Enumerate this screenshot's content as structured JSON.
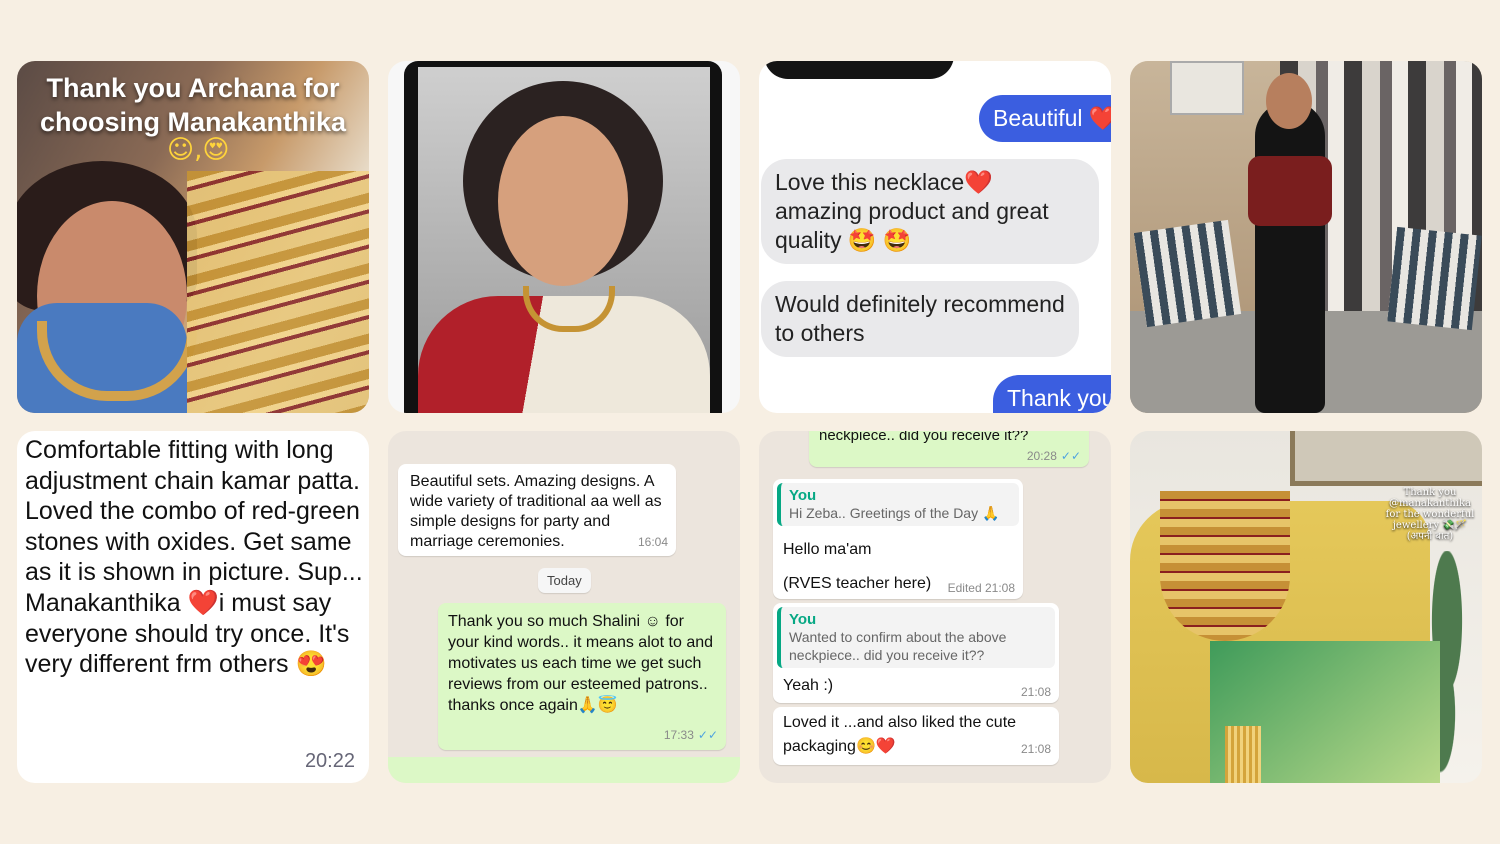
{
  "tile1": {
    "caption_line1": "Thank you Archana for",
    "caption_line2": "choosing Manakanthika",
    "emojis": "☺,😍"
  },
  "tile3": {
    "bubble1": "Beautiful ❤️",
    "bubble2": "Love this necklace❤️ amazing product and great quality 🤩 🤩",
    "bubble3": "Would definitely recommend to others",
    "bubble4": "Thank you"
  },
  "tile5": {
    "text": "Comfortable fitting with long adjustment chain kamar patta. Loved the combo of red-green stones with oxides. Get same as it is shown in picture. Sup... Manakanthika ❤️i must say everyone should try once. It's very different frm others 😍",
    "time": "20:22"
  },
  "tile6": {
    "msg1": "Beautiful sets. Amazing designs. A wide variety of traditional aa well as simple designs for party and marriage ceremonies.",
    "msg1_time": "16:04",
    "today": "Today",
    "msg2": "Thank you so much Shalini ☺ for your kind words.. it means alot to and motivates us each time we get such reviews from our esteemed patrons.. thanks once again🙏😇",
    "msg2_time": "17:33",
    "tick": "✓✓"
  },
  "tile7": {
    "top_msg": "neckpiece.. did you receive it??",
    "top_time": "20:28",
    "q1_name": "You",
    "q1_quote": "Hi Zeba.. Greetings of the Day 🙏",
    "q1_msg_a": "Hello ma'am",
    "q1_msg_b": "(RVES teacher here)",
    "q1_time": "Edited 21:08",
    "q2_name": "You",
    "q2_quote": "Wanted to confirm about the above neckpiece.. did you receive it??",
    "q2_msg": "Yeah :)",
    "q2_time": "21:08",
    "q3_msg": "Loved it ...and also liked the cute packaging😊❤️",
    "q3_time": "21:08",
    "tick": "✓✓"
  },
  "tile8": {
    "caption": "Thank you @manakanthika for the wonderful jewellery 💸🪄 (अपनी बात)"
  }
}
